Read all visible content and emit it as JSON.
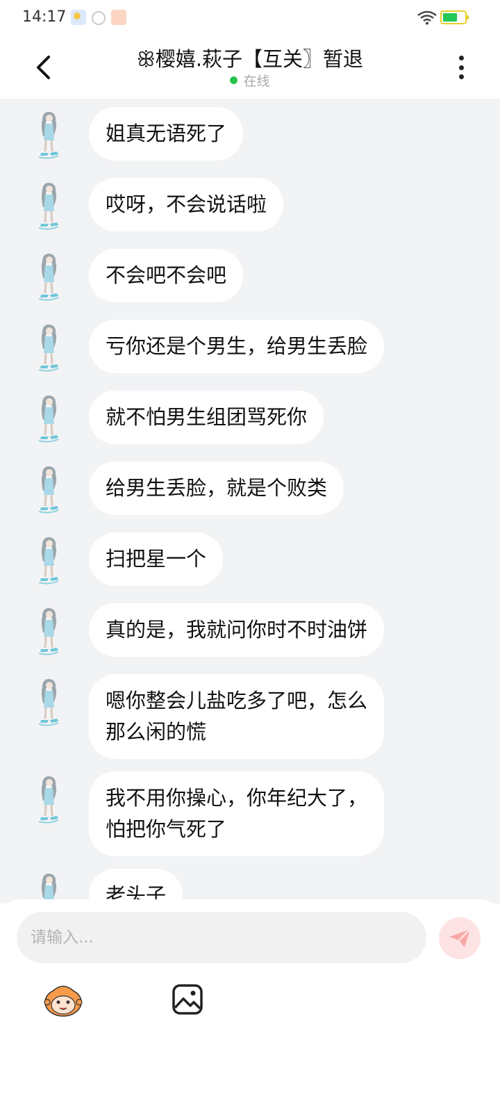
{
  "status_bar": {
    "time": "14:17",
    "icons": [
      "weather-icon",
      "timer-icon",
      "app-notification-icon",
      "wifi-icon",
      "battery-charging-icon"
    ]
  },
  "header": {
    "title": "ꕥ樱嬉.萩子【互关〗暂退",
    "status": "在线",
    "back_icon": "chevron-left-icon",
    "more_icon": "more-vertical-icon"
  },
  "messages": [
    {
      "lines": [
        "姐真无语死了"
      ]
    },
    {
      "lines": [
        "哎呀，不会说话啦"
      ]
    },
    {
      "lines": [
        "不会吧不会吧"
      ]
    },
    {
      "lines": [
        "亏你还是个男生，给男生丢脸"
      ]
    },
    {
      "lines": [
        "就不怕男生组团骂死你"
      ]
    },
    {
      "lines": [
        "给男生丢脸，就是个败类"
      ]
    },
    {
      "lines": [
        "扫把星一个"
      ]
    },
    {
      "lines": [
        "真的是，我就问你时不时油饼"
      ]
    },
    {
      "lines": [
        "嗯你整会儿盐吃多了吧，怎么",
        "那么闲的慌"
      ]
    },
    {
      "lines": [
        "我不用你操心，你年纪大了，",
        "怕把你气死了"
      ]
    },
    {
      "lines": [
        "老头子"
      ]
    }
  ],
  "composer": {
    "placeholder": "请输入...",
    "send_icon": "send-icon",
    "emoji_icon": "emoji-icon",
    "image_icon": "image-icon"
  },
  "colors": {
    "chat_background": "#f2f3f5",
    "online_dot": "#27c24c",
    "send_button": "#fde3e3",
    "send_icon": "#f6a8a8"
  }
}
